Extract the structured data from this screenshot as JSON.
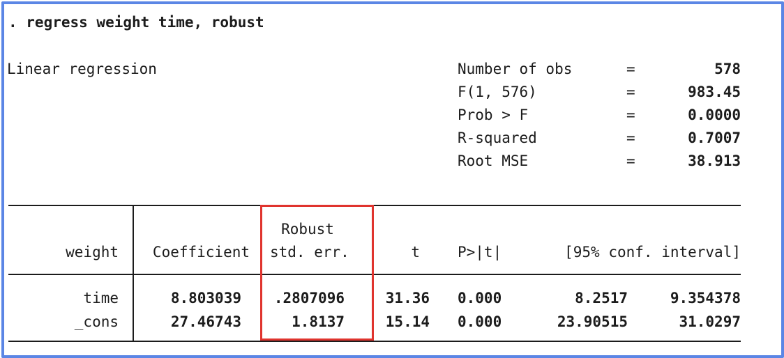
{
  "command": ". regress weight time, robust",
  "model_title": "Linear regression",
  "stats": [
    {
      "label": "Number of obs",
      "eq": "=",
      "value": "578"
    },
    {
      "label": "F(1, 576)",
      "eq": "=",
      "value": "983.45"
    },
    {
      "label": "Prob > F",
      "eq": "=",
      "value": "0.0000"
    },
    {
      "label": "R-squared",
      "eq": "=",
      "value": "0.7007"
    },
    {
      "label": "Root MSE",
      "eq": "=",
      "value": "38.913"
    }
  ],
  "table": {
    "header": {
      "depvar": "weight",
      "coef": "Coefficient",
      "se_top": "Robust",
      "se": "std. err.",
      "t": "t",
      "p": "P>|t|",
      "ci": "[95% conf. interval]"
    },
    "rows": [
      {
        "var": "time",
        "coef": "8.803039",
        "se": ".2807096",
        "t": "31.36",
        "p": "0.000",
        "ci_low": "8.2517",
        "ci_high": "9.354378"
      },
      {
        "var": "_cons",
        "coef": "27.46743",
        "se": "1.8137",
        "t": "15.14",
        "p": "0.000",
        "ci_low": "23.90515",
        "ci_high": "31.0297"
      }
    ]
  },
  "colors": {
    "frame": "#5b86e5",
    "highlight": "#e0342e",
    "text": "#1c1c1c"
  }
}
